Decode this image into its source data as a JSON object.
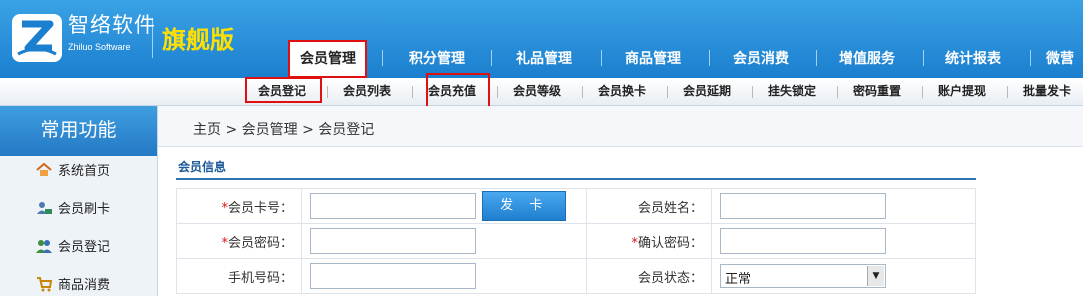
{
  "brand": {
    "name_cn": "智络软件",
    "name_en": "Zhiluo Software",
    "edition": "旗舰版"
  },
  "main_nav": [
    "会员管理",
    "积分管理",
    "礼品管理",
    "商品管理",
    "会员消费",
    "增值服务",
    "统计报表",
    "微营"
  ],
  "sub_nav": [
    "会员登记",
    "会员列表",
    "会员充值",
    "会员等级",
    "会员换卡",
    "会员延期",
    "挂失锁定",
    "密码重置",
    "账户提现",
    "批量发卡"
  ],
  "sidebar": {
    "title": "常用功能",
    "items": [
      {
        "label": "系统首页",
        "icon": "home-icon"
      },
      {
        "label": "会员刷卡",
        "icon": "user-card-icon"
      },
      {
        "label": "会员登记",
        "icon": "users-icon"
      },
      {
        "label": "商品消费",
        "icon": "cart-icon"
      }
    ]
  },
  "breadcrumb": "主页 > 会员管理 > 会员登记",
  "section_title": "会员信息",
  "form": {
    "card_no_label": "会员卡号：",
    "issue_button": "发 卡",
    "name_label": "会员姓名：",
    "password_label": "会员密码：",
    "confirm_label": "确认密码：",
    "phone_label": "手机号码：",
    "status_label": "会员状态：",
    "status_value": "正常",
    "required_mark": "*"
  },
  "colors": {
    "header": "#2b8fdb",
    "edition": "#ffe000",
    "highlight": "#e01010"
  }
}
